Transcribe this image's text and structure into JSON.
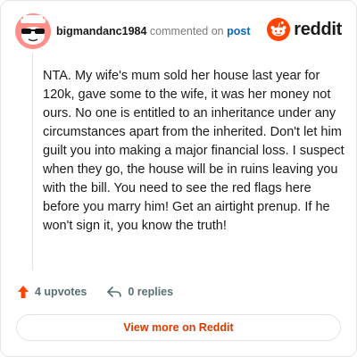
{
  "comment": {
    "username": "bigmandanc1984",
    "action_text": "commented on",
    "post_link_text": "post",
    "body": "NTA. My wife's mum sold her house last year for 120k, gave some to the wife, it was her money not ours. No one is entitled to an inheritance under any circumstances apart from the inherited. Don't let him guilt you into making a major financial loss. I suspect when they go, the house will be in ruins leaving you with the bill. You need to see the red flags here before you marry him! Get an airtight prenup. If he won't sign it, you know the truth!"
  },
  "brand": {
    "name": "reddit",
    "icon": "reddit-snoo-icon",
    "color": "#ff4500"
  },
  "stats": {
    "upvotes": "4 upvotes",
    "replies": "0 replies",
    "upvote_icon": "upvote-arrow-icon",
    "reply_icon": "reply-arrow-icon",
    "upvote_color": "#ff4500"
  },
  "cta": {
    "label": "View more on Reddit",
    "color": "#d93a00"
  },
  "avatar": {
    "background": "#ff8f88",
    "icon": "snoo-avatar-with-sunglasses"
  }
}
